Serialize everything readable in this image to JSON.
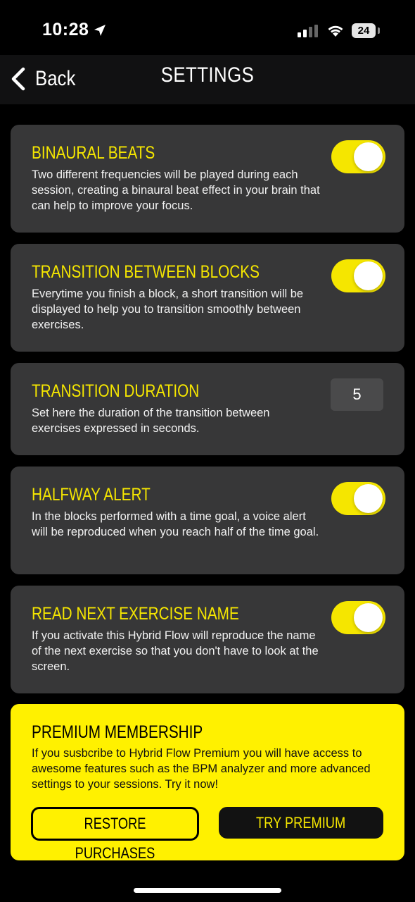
{
  "status_bar": {
    "time": "10:28",
    "battery": "24",
    "icons": [
      "location-arrow-icon",
      "cellular-signal-icon",
      "wifi-icon",
      "battery-icon"
    ]
  },
  "nav": {
    "back_label": "Back",
    "title": "SETTINGS"
  },
  "settings": [
    {
      "title": "BINAURAL BEATS",
      "description": "Two different frequencies will be played during each session, creating a binaural beat effect in your brain that can help to improve your focus.",
      "control": "toggle",
      "enabled": true
    },
    {
      "title": "TRANSITION BETWEEN BLOCKS",
      "description": "Everytime you finish a block, a short transition will be displayed to help you to transition smoothly between exercises.",
      "control": "toggle",
      "enabled": true
    },
    {
      "title": "TRANSITION DURATION",
      "description": "Set here the duration of the transition between exercises expressed in seconds.",
      "control": "number",
      "value": "5"
    },
    {
      "title": "HALFWAY ALERT",
      "description": "In the blocks performed with a time goal, a voice alert will be reproduced when you reach half of the time goal.",
      "control": "toggle",
      "enabled": true
    },
    {
      "title": "READ NEXT EXERCISE NAME",
      "description": "If you activate this Hybrid Flow will reproduce the name of the next exercise so that you don't have to look at the screen.",
      "control": "toggle",
      "enabled": true
    }
  ],
  "premium": {
    "title": "PREMIUM MEMBERSHIP",
    "description": "If you susbcribe to Hybrid Flow Premium you will have access to awesome features such as the BPM analyzer and more advanced settings to your sessions. Try it now!",
    "restore_label": "RESTORE PURCHASES",
    "try_label": "TRY PREMIUM"
  },
  "colors": {
    "accent": "#f5e600",
    "card_bg": "#373738",
    "premium_bg": "#fff100",
    "page_bg": "#000000"
  }
}
